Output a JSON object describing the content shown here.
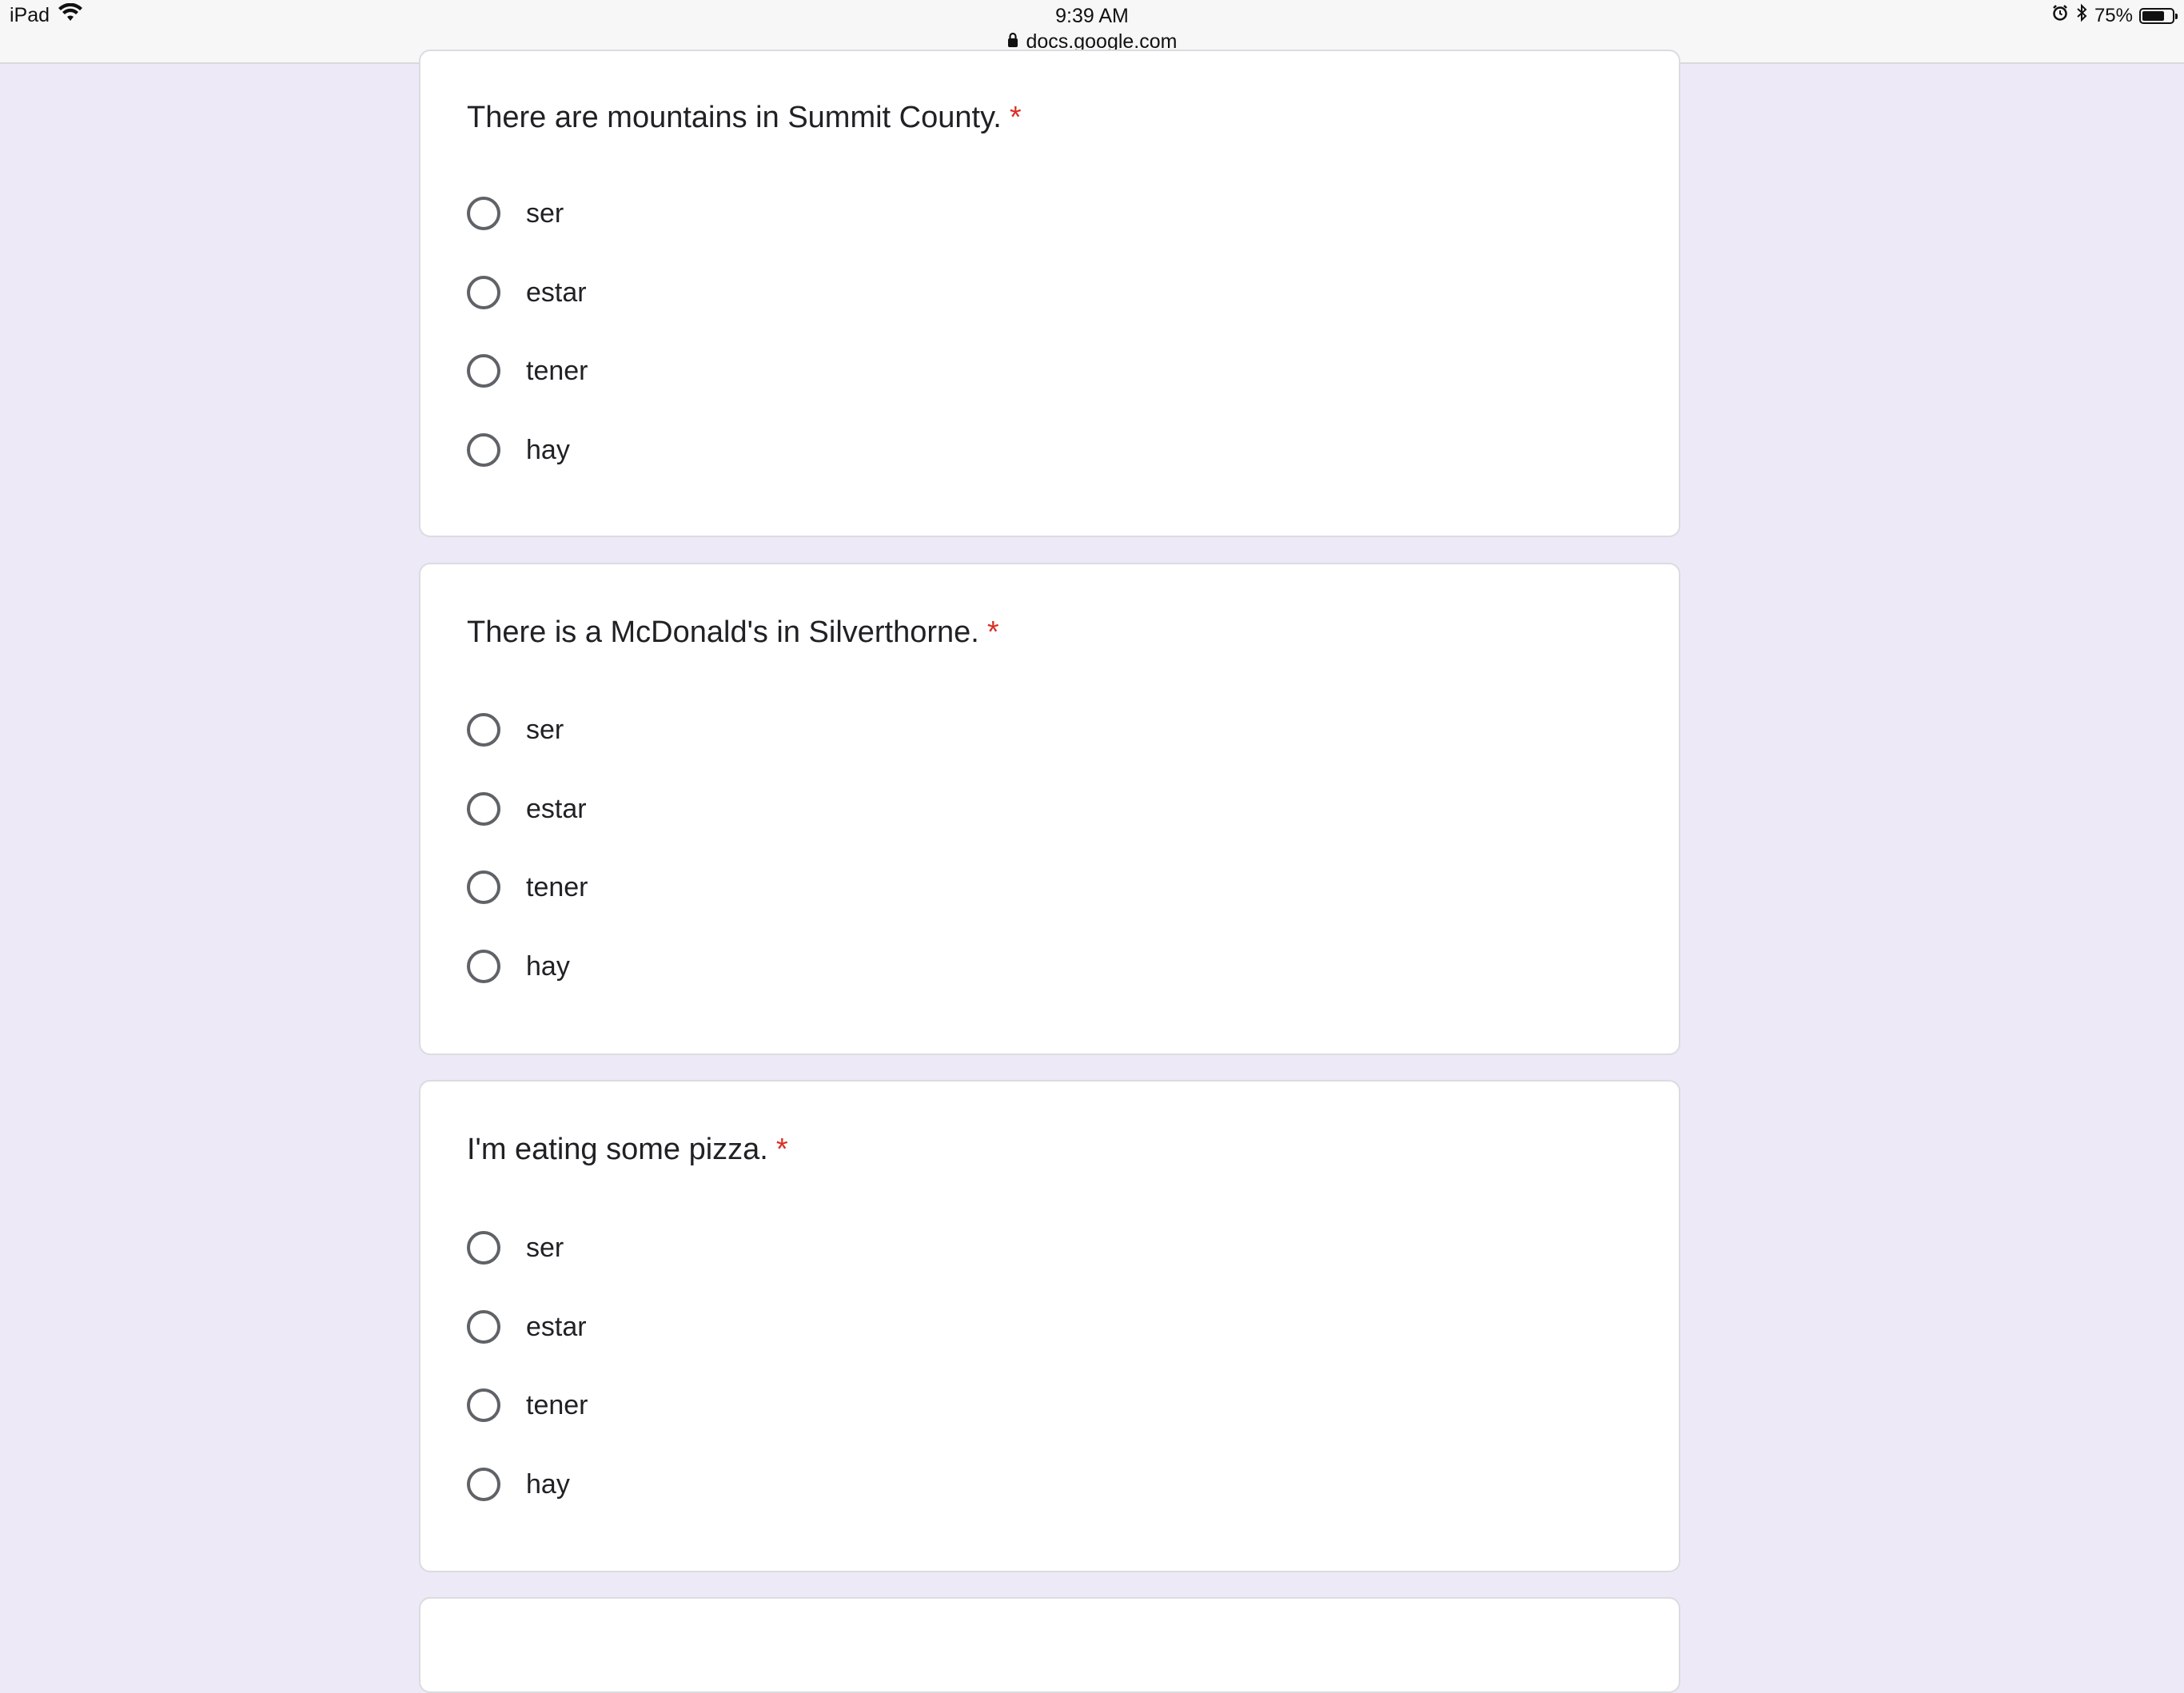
{
  "status_bar": {
    "device": "iPad",
    "time": "9:39 AM",
    "url": "docs.google.com",
    "battery_text": "75%",
    "battery_level": 0.75,
    "icons": [
      "wifi-icon",
      "lock-icon",
      "alarm-icon",
      "bluetooth-icon",
      "battery-icon"
    ]
  },
  "colors": {
    "page_background": "#ede9f6",
    "required_asterisk": "#d93025",
    "radio_border": "#5f6368"
  },
  "questions": [
    {
      "title": "There are mountains in Summit County.",
      "required_mark": "*",
      "options": [
        "ser",
        "estar",
        "tener",
        "hay"
      ]
    },
    {
      "title": "There is a McDonald's in Silverthorne.",
      "required_mark": "*",
      "options": [
        "ser",
        "estar",
        "tener",
        "hay"
      ]
    },
    {
      "title": "I'm eating some pizza.",
      "required_mark": "*",
      "options": [
        "ser",
        "estar",
        "tener",
        "hay"
      ]
    }
  ]
}
